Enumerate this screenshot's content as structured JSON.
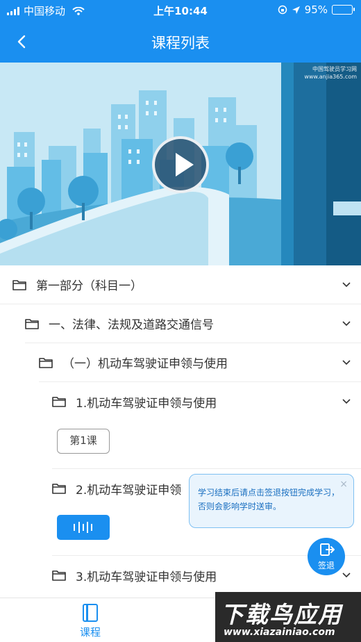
{
  "status_bar": {
    "carrier": "中国移动",
    "time": "上午10:44",
    "battery": "95%",
    "battery_level": 0.95
  },
  "nav": {
    "title": "课程列表",
    "back_icon": "chevron-left-icon"
  },
  "banner": {
    "watermark_line1": "中国驾驶员学习网",
    "watermark_line2": "www.anjia365.com",
    "play_icon": "play-icon"
  },
  "tree": {
    "part": "第一部分（科目一）",
    "chapter": "一、法律、法规及道路交通信号",
    "section": "（一）机动车驾驶证申领与使用",
    "item1": "1.机动车驾驶证申领与使用",
    "lesson1": "第1课",
    "item2": "2.机动车驾驶证申领",
    "item3": "3.机动车驾驶证申领与使用"
  },
  "tooltip": {
    "text_line1": "学习结束后请点击签退按钮完成学习，",
    "text_line2": "否则会影响学时送审。",
    "close": "×"
  },
  "signout": {
    "label": "签退"
  },
  "tabbar": {
    "course": "课程"
  },
  "watermark": {
    "line1": "下载鸟应用",
    "line2": "www.xiazainiao.com"
  },
  "colors": {
    "primary": "#1a8ff0",
    "tooltip_bg": "#e9f4fd"
  }
}
